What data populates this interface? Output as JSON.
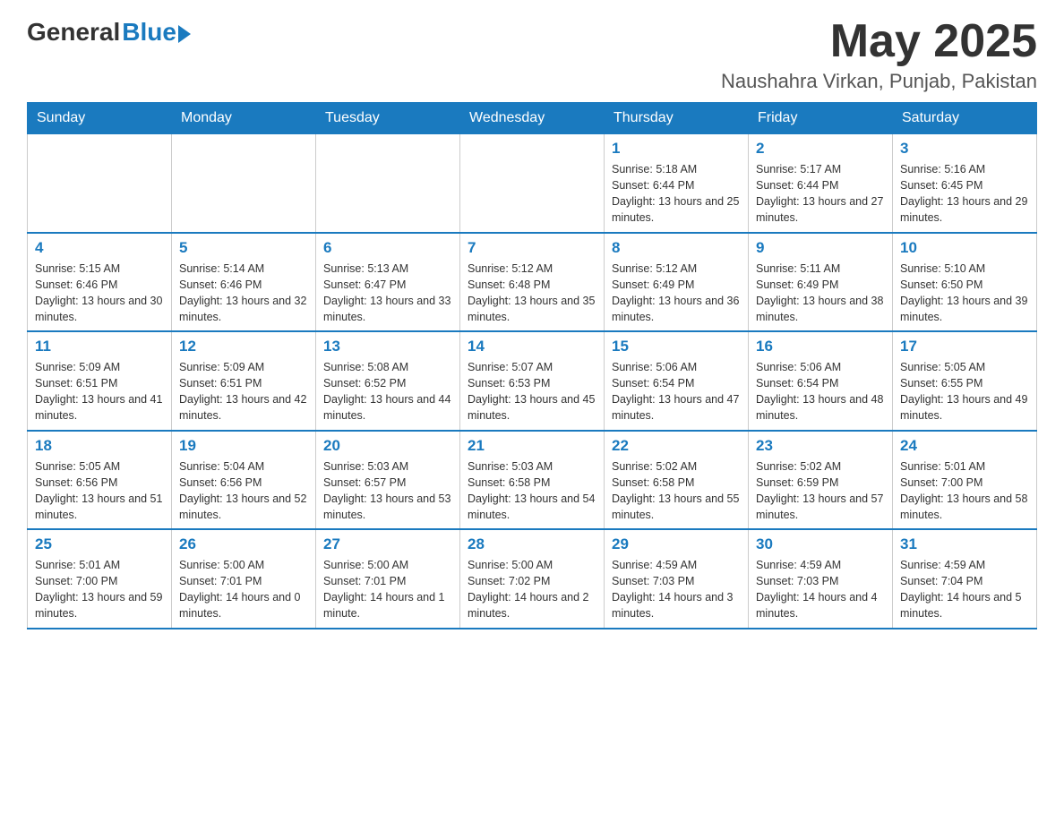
{
  "logo": {
    "general": "General",
    "blue": "Blue"
  },
  "header": {
    "month": "May 2025",
    "location": "Naushahra Virkan, Punjab, Pakistan"
  },
  "days_of_week": [
    "Sunday",
    "Monday",
    "Tuesday",
    "Wednesday",
    "Thursday",
    "Friday",
    "Saturday"
  ],
  "weeks": [
    [
      {
        "day": "",
        "info": ""
      },
      {
        "day": "",
        "info": ""
      },
      {
        "day": "",
        "info": ""
      },
      {
        "day": "",
        "info": ""
      },
      {
        "day": "1",
        "info": "Sunrise: 5:18 AM\nSunset: 6:44 PM\nDaylight: 13 hours and 25 minutes."
      },
      {
        "day": "2",
        "info": "Sunrise: 5:17 AM\nSunset: 6:44 PM\nDaylight: 13 hours and 27 minutes."
      },
      {
        "day": "3",
        "info": "Sunrise: 5:16 AM\nSunset: 6:45 PM\nDaylight: 13 hours and 29 minutes."
      }
    ],
    [
      {
        "day": "4",
        "info": "Sunrise: 5:15 AM\nSunset: 6:46 PM\nDaylight: 13 hours and 30 minutes."
      },
      {
        "day": "5",
        "info": "Sunrise: 5:14 AM\nSunset: 6:46 PM\nDaylight: 13 hours and 32 minutes."
      },
      {
        "day": "6",
        "info": "Sunrise: 5:13 AM\nSunset: 6:47 PM\nDaylight: 13 hours and 33 minutes."
      },
      {
        "day": "7",
        "info": "Sunrise: 5:12 AM\nSunset: 6:48 PM\nDaylight: 13 hours and 35 minutes."
      },
      {
        "day": "8",
        "info": "Sunrise: 5:12 AM\nSunset: 6:49 PM\nDaylight: 13 hours and 36 minutes."
      },
      {
        "day": "9",
        "info": "Sunrise: 5:11 AM\nSunset: 6:49 PM\nDaylight: 13 hours and 38 minutes."
      },
      {
        "day": "10",
        "info": "Sunrise: 5:10 AM\nSunset: 6:50 PM\nDaylight: 13 hours and 39 minutes."
      }
    ],
    [
      {
        "day": "11",
        "info": "Sunrise: 5:09 AM\nSunset: 6:51 PM\nDaylight: 13 hours and 41 minutes."
      },
      {
        "day": "12",
        "info": "Sunrise: 5:09 AM\nSunset: 6:51 PM\nDaylight: 13 hours and 42 minutes."
      },
      {
        "day": "13",
        "info": "Sunrise: 5:08 AM\nSunset: 6:52 PM\nDaylight: 13 hours and 44 minutes."
      },
      {
        "day": "14",
        "info": "Sunrise: 5:07 AM\nSunset: 6:53 PM\nDaylight: 13 hours and 45 minutes."
      },
      {
        "day": "15",
        "info": "Sunrise: 5:06 AM\nSunset: 6:54 PM\nDaylight: 13 hours and 47 minutes."
      },
      {
        "day": "16",
        "info": "Sunrise: 5:06 AM\nSunset: 6:54 PM\nDaylight: 13 hours and 48 minutes."
      },
      {
        "day": "17",
        "info": "Sunrise: 5:05 AM\nSunset: 6:55 PM\nDaylight: 13 hours and 49 minutes."
      }
    ],
    [
      {
        "day": "18",
        "info": "Sunrise: 5:05 AM\nSunset: 6:56 PM\nDaylight: 13 hours and 51 minutes."
      },
      {
        "day": "19",
        "info": "Sunrise: 5:04 AM\nSunset: 6:56 PM\nDaylight: 13 hours and 52 minutes."
      },
      {
        "day": "20",
        "info": "Sunrise: 5:03 AM\nSunset: 6:57 PM\nDaylight: 13 hours and 53 minutes."
      },
      {
        "day": "21",
        "info": "Sunrise: 5:03 AM\nSunset: 6:58 PM\nDaylight: 13 hours and 54 minutes."
      },
      {
        "day": "22",
        "info": "Sunrise: 5:02 AM\nSunset: 6:58 PM\nDaylight: 13 hours and 55 minutes."
      },
      {
        "day": "23",
        "info": "Sunrise: 5:02 AM\nSunset: 6:59 PM\nDaylight: 13 hours and 57 minutes."
      },
      {
        "day": "24",
        "info": "Sunrise: 5:01 AM\nSunset: 7:00 PM\nDaylight: 13 hours and 58 minutes."
      }
    ],
    [
      {
        "day": "25",
        "info": "Sunrise: 5:01 AM\nSunset: 7:00 PM\nDaylight: 13 hours and 59 minutes."
      },
      {
        "day": "26",
        "info": "Sunrise: 5:00 AM\nSunset: 7:01 PM\nDaylight: 14 hours and 0 minutes."
      },
      {
        "day": "27",
        "info": "Sunrise: 5:00 AM\nSunset: 7:01 PM\nDaylight: 14 hours and 1 minute."
      },
      {
        "day": "28",
        "info": "Sunrise: 5:00 AM\nSunset: 7:02 PM\nDaylight: 14 hours and 2 minutes."
      },
      {
        "day": "29",
        "info": "Sunrise: 4:59 AM\nSunset: 7:03 PM\nDaylight: 14 hours and 3 minutes."
      },
      {
        "day": "30",
        "info": "Sunrise: 4:59 AM\nSunset: 7:03 PM\nDaylight: 14 hours and 4 minutes."
      },
      {
        "day": "31",
        "info": "Sunrise: 4:59 AM\nSunset: 7:04 PM\nDaylight: 14 hours and 5 minutes."
      }
    ]
  ]
}
